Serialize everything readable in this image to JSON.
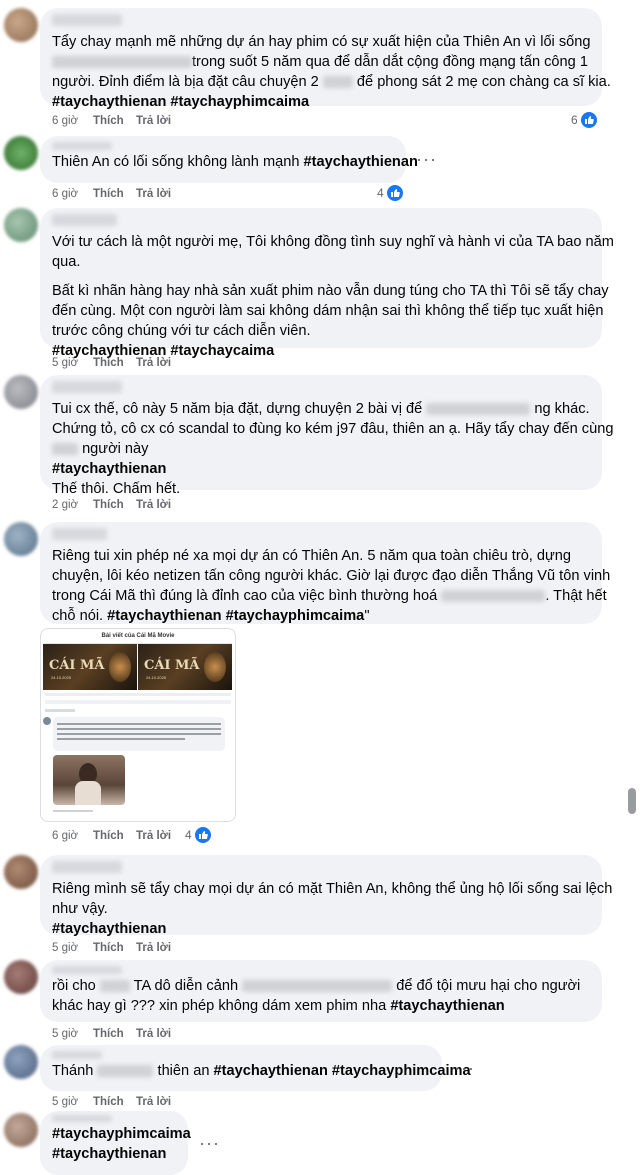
{
  "comments": [
    {
      "lines": [
        [
          "Tẩy chay mạnh mẽ những dự án hay phim có sự xuất hiện của Thiên An vì lối sống"
        ],
        [
          "",
          "trong suốt 5 năm qua để dẫn dắt cộng đồng mạng tấn công 1"
        ],
        [
          "người. Đỉnh điểm là bịa đặt câu chuyện 2",
          "để phong sát 2 mẹ con chàng ca sĩ kia."
        ]
      ],
      "tags": "#taychaythienan #taychayphimcaima",
      "time": "6 giờ",
      "like": "Thích",
      "reply": "Trả lời",
      "reactions": "6"
    },
    {
      "lines": [
        [
          "Thiên An có lối sống không lành mạnh ",
          "#taychaythienan"
        ]
      ],
      "time": "6 giờ",
      "like": "Thích",
      "reply": "Trả lời",
      "reactions": "4"
    },
    {
      "para1": [
        "Với tư cách là một người mẹ, Tôi không đồng tình suy nghĩ và hành vi của TA bao năm",
        "qua."
      ],
      "para2": [
        "Bất kì nhãn hàng hay nhà sản xuất phim nào vẫn dung túng cho TA thì Tôi sẽ tẩy chay",
        "đến cùng. Một con người làm sai không dám nhận sai thì không thể tiếp tục xuất hiện",
        "trước công chúng với tư cách diễn viên."
      ],
      "tags": "#taychaythienan #taychaycaima",
      "time": "5 giờ",
      "like": "Thích",
      "reply": "Trả lời"
    },
    {
      "l1a": "Tui cx thế, cô này 5 năm bịa đặt, dựng chuyện 2 bài vị để",
      "l1b": "ng khác.",
      "l2": "Chứng tỏ, cô cx có scandal to đùng ko kém j97 đâu, thiên an ạ. Hãy tẩy chay đến cùng",
      "l3": "người này",
      "tags": "#taychaythienan",
      "l5": "Thế thôi. Chấm hết.",
      "time": "2 giờ",
      "like": "Thích",
      "reply": "Trả lời"
    },
    {
      "l1": "Riêng tui xin phép né xa mọi dự án có Thiên An. 5 năm qua toàn chiêu trò, dựng",
      "l2": "chuyện, lôi kéo netizen tấn công người khác. Giờ lại được đạo diễn Thắng Vũ tôn vinh",
      "l3a": "trong Cái Mã thì đúng là đỉnh cao của việc bình thường hoá",
      "l3b": ". Thật hết",
      "l4a": "chỗ nói. ",
      "l4b": "#taychaythienan #taychayphimcaima",
      "l4c": "\"",
      "attach_title": "Bài viết của Cái Mã Movie",
      "poster_title": "CÁI MÃ",
      "poster_date": "24.10.2025",
      "time": "6 giờ",
      "like": "Thích",
      "reply": "Trả lời",
      "reactions": "4"
    },
    {
      "l1": "Riêng mình sẽ tẩy chay mọi dự án có mặt Thiên An, không thể ủng hộ lối sống sai lệch",
      "l2": "như vậy.",
      "tags": "#taychaythienan",
      "time": "5 giờ",
      "like": "Thích",
      "reply": "Trả lời"
    },
    {
      "l1a": "rồi cho",
      "l1b": "TA dô diễn cảnh",
      "l1c": "để đổ tội mưu hại cho người",
      "l2a": "khác hay gì ??? xin phép không dám xem phim nha ",
      "l2b": "#taychaythienan",
      "time": "5 giờ",
      "like": "Thích",
      "reply": "Trả lời"
    },
    {
      "l1a": "Thánh",
      "l1b": "thiên an ",
      "l1c": "#taychaythienan #taychayphimcaima",
      "time": "5 giờ",
      "like": "Thích",
      "reply": "Trả lời"
    },
    {
      "l1": "#taychayphimcaima",
      "l2": "#taychaythienan"
    }
  ],
  "icons": {
    "more": "more-dots-icon",
    "like": "like-thumb-icon"
  },
  "colors": {
    "bubble": "#f0f2f5",
    "meta": "#65676b",
    "like_blue": "#1877f2"
  }
}
